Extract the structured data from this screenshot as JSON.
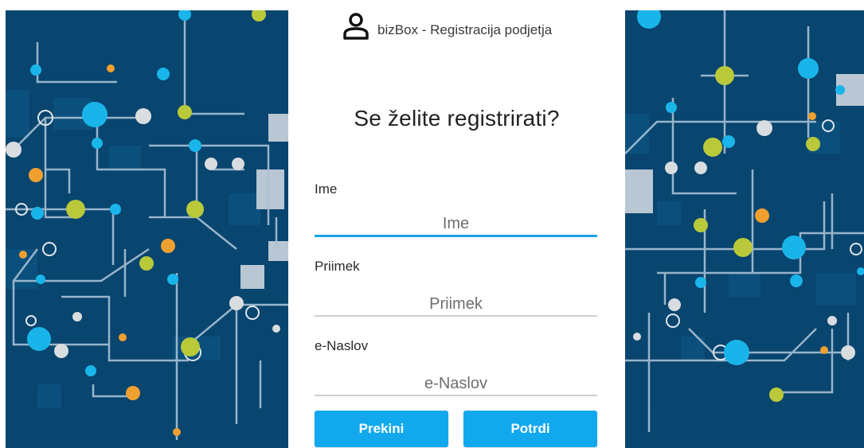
{
  "brand": {
    "title": "bizBox - Registracija podjetja",
    "icon": "user-icon"
  },
  "form": {
    "heading": "Se želite registrirati?",
    "fields": [
      {
        "label": "Ime",
        "placeholder": "Ime",
        "value": ""
      },
      {
        "label": "Priimek",
        "placeholder": "Priimek",
        "value": ""
      },
      {
        "label": "e-Naslov",
        "placeholder": "e-Naslov",
        "value": ""
      }
    ],
    "cancel_label": "Prekini",
    "confirm_label": "Potrdi"
  },
  "colors": {
    "accent": "#12a8ee",
    "art_background": "#08456f",
    "dot_cyan": "#19b5ea",
    "dot_lime": "#b9c93a",
    "dot_orange": "#f0a030",
    "dot_light": "#d9dde0"
  }
}
